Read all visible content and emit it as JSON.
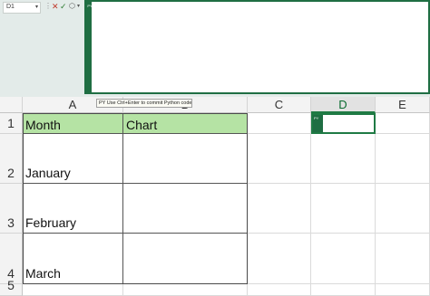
{
  "formula_bar": {
    "name_box": "D1",
    "python_badge": "PY"
  },
  "tooltip": "PY Use Ctrl+Enter to commit Python code",
  "columns": [
    "A",
    "B",
    "C",
    "D",
    "E"
  ],
  "rows": [
    "1",
    "2",
    "3",
    "4",
    "5"
  ],
  "active_cell": {
    "ref": "D1",
    "python_badge": "PY"
  },
  "table": {
    "headers": [
      "Month",
      "Chart"
    ],
    "months": [
      "January",
      "February",
      "March"
    ]
  },
  "colors": {
    "accent": "#1f7a44",
    "header_fill": "#b5e3a4"
  },
  "icons": [
    "cancel-icon",
    "enter-icon",
    "python-menu-icon",
    "chevron-down-icon"
  ]
}
